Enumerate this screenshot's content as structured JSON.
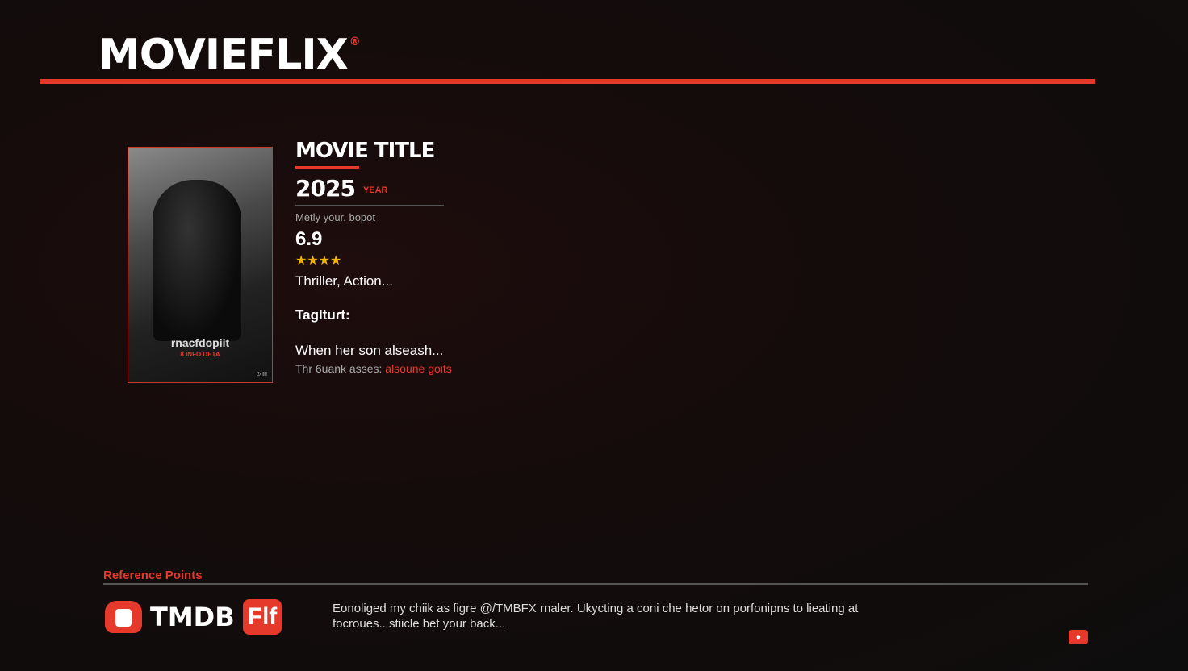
{
  "header": {
    "logo": "MOVIEFLIX",
    "registered": "®"
  },
  "poster": {
    "title": "rnacfdopiit",
    "subtitle": "8 INFO DETA",
    "corner": "⊙ III"
  },
  "movie": {
    "title": "MOVIE TITLE",
    "year": "2025",
    "year_label": "YEAR",
    "meta": "Metly your. bopot",
    "rating": "6.9",
    "stars": "★★★★",
    "genres": "Thriller, Action...",
    "tagline_label": "Tagltuɾt:",
    "description": "When her son alseash...",
    "sub_prefix": "Thr 6uank asses:",
    "sub_link": "alsoune goits"
  },
  "footer": {
    "section_title": "Reference Points",
    "brand": "TMDB",
    "brand_badge": "Flf",
    "text": "Eonoliged my chiik as figre @/TMBFX rnaler. Ukycting a coni che hetor on porfonipns to lieating at focroues.. stiicle bet your back...",
    "corner_icon": "●"
  },
  "colors": {
    "accent": "#e5392b",
    "star": "#f5b400"
  }
}
